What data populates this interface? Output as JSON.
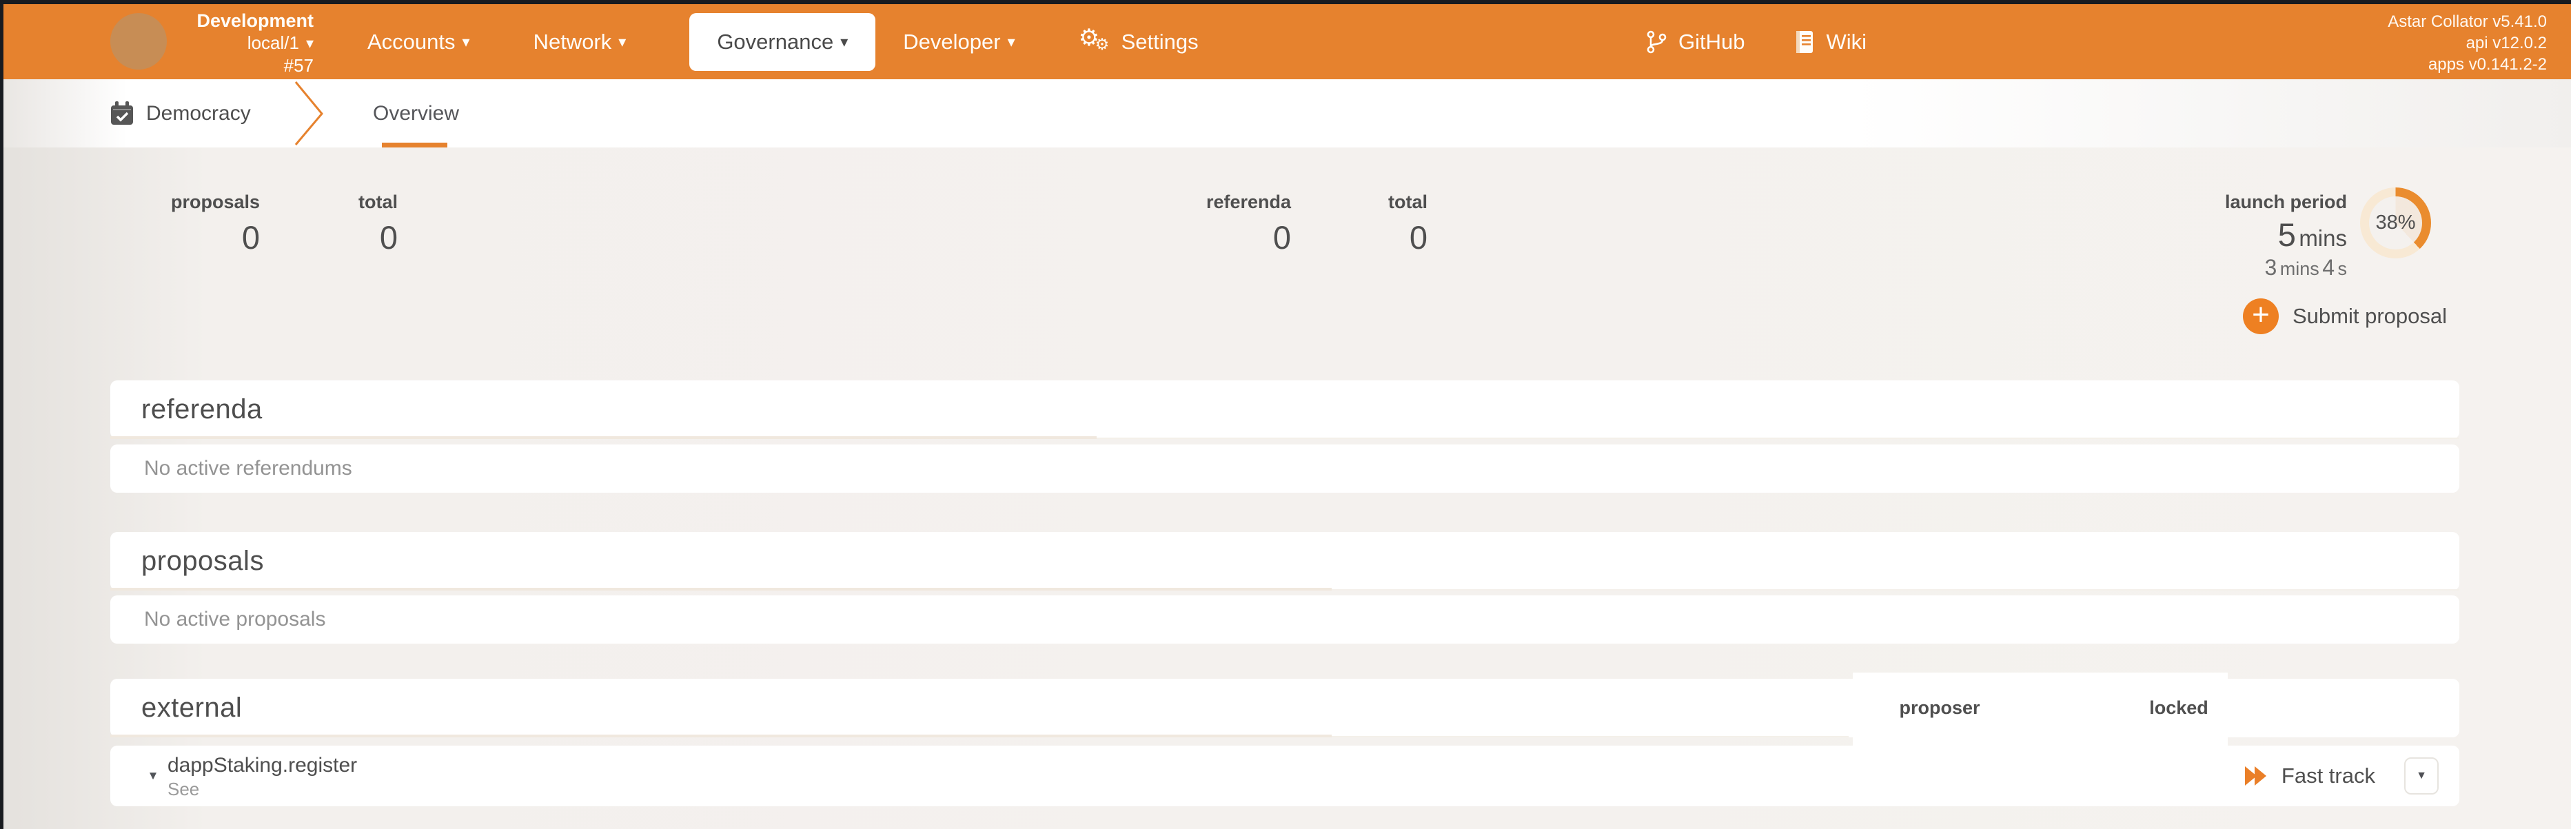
{
  "app": {
    "accent": "#e6822e",
    "dark_edge": "#181b20"
  },
  "icons": {
    "caret_down": "▾",
    "caret_down_small": "▼",
    "gear": "⚙",
    "plus": "+"
  },
  "header": {
    "chain": {
      "name": "Development",
      "endpoint": "local/1",
      "block_number": "#57"
    },
    "nav": {
      "accounts": "Accounts",
      "network": "Network",
      "governance": "Governance",
      "developer": "Developer",
      "settings": "Settings"
    },
    "links": {
      "github": "GitHub",
      "wiki": "Wiki"
    },
    "versions": {
      "node": "Astar Collator v5.41.0",
      "api": "api v12.0.2",
      "apps": "apps v0.141.2-2"
    }
  },
  "tabs": {
    "section": "Democracy",
    "overview": "Overview"
  },
  "summary": {
    "proposals": {
      "label": "proposals",
      "value": "0"
    },
    "proposals_total": {
      "label": "total",
      "value": "0"
    },
    "referenda": {
      "label": "referenda",
      "value": "0"
    },
    "referenda_total": {
      "label": "total",
      "value": "0"
    },
    "launch_period": {
      "label": "launch period",
      "value": "5",
      "unit": "mins",
      "elapsed_v1": "3",
      "elapsed_u1": "mins",
      "elapsed_v2": "4",
      "elapsed_u2": "s",
      "percent": "38%"
    }
  },
  "actions": {
    "submit_proposal": "Submit proposal"
  },
  "sections": {
    "referenda": {
      "title": "referenda",
      "empty": "No active referendums"
    },
    "proposals": {
      "title": "proposals",
      "empty": "No active proposals"
    },
    "external": {
      "title": "external",
      "col_proposer": "proposer",
      "col_locked": "locked",
      "row": {
        "method": "dappStaking.register",
        "note": "See",
        "fast_track": "Fast track"
      }
    }
  }
}
